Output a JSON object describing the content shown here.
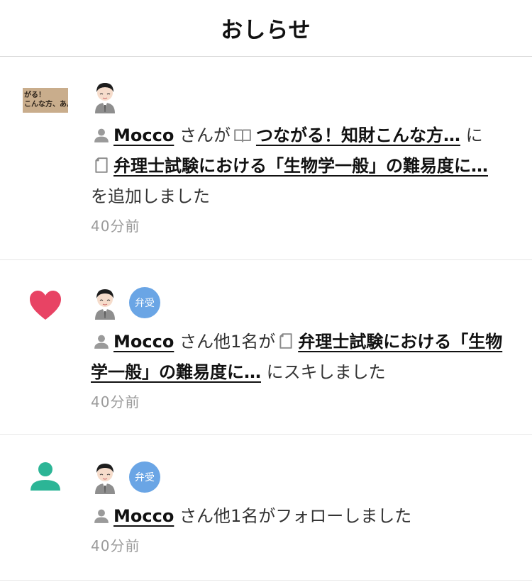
{
  "header": {
    "title": "おしらせ"
  },
  "notifications": [
    {
      "thumb_lines": [
        "がる！",
        "こんな方、あん"
      ],
      "user": "Mocco",
      "text_after_user": " さんが",
      "magazine_link": "つながる！知財こんな方…",
      "connector": " に",
      "note_link": "弁理士試験における「生物学一般」の難易度に…",
      "text_end": " を追加しました",
      "time": "40分前"
    },
    {
      "badge": "弁受",
      "user": "Mocco",
      "text_after_user": " さん他1名が",
      "note_link": "弁理士試験における「生物学一般」の難易度に…",
      "text_end": " にスキしました",
      "time": "40分前"
    },
    {
      "badge": "弁受",
      "user": "Mocco",
      "text_after_user": " さん他1名がフォローしました",
      "time": "40分前"
    }
  ],
  "colors": {
    "like": "#e84364",
    "follow": "#2cb596",
    "badge": "#6aa5e5",
    "muted": "#9b9b9b"
  },
  "icons": [
    "user-icon",
    "magazine-icon",
    "note-icon",
    "heart-icon",
    "follow-icon",
    "avatar"
  ]
}
